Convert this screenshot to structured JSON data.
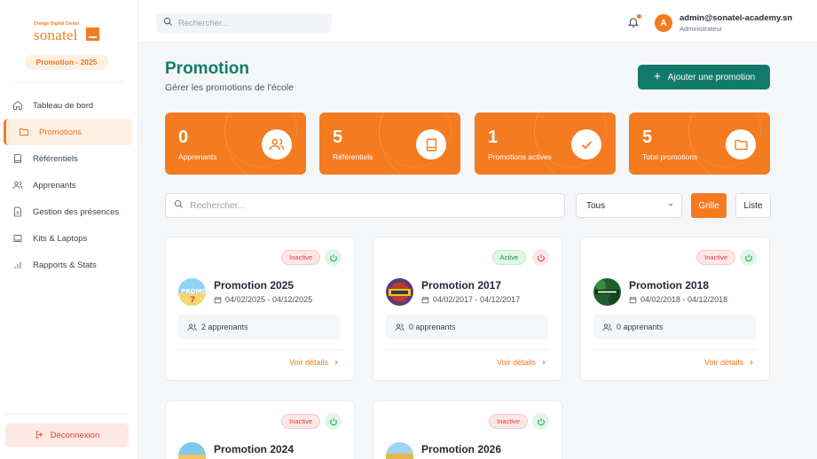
{
  "sidebar": {
    "logo_tagline": "Orange Digital Center",
    "logo_word": "sonatel",
    "promo_pill": "Promotion - 2025",
    "nav": [
      {
        "label": "Tableau de bord",
        "icon": "home-icon"
      },
      {
        "label": "Promotions",
        "icon": "folder-icon",
        "active": true
      },
      {
        "label": "Référentiels",
        "icon": "book-icon"
      },
      {
        "label": "Apprenants",
        "icon": "users-icon"
      },
      {
        "label": "Gestion des présences",
        "icon": "document-icon"
      },
      {
        "label": "Kits & Laptops",
        "icon": "laptop-icon"
      },
      {
        "label": "Rapports & Stats",
        "icon": "bar-chart-icon"
      }
    ],
    "logout_label": "Déconnexion"
  },
  "topbar": {
    "search_placeholder": "Rechercher...",
    "avatar_letter": "A",
    "user_email": "admin@sonatel-academy.sn",
    "user_role": "Administrateur"
  },
  "main": {
    "title": "Promotion",
    "subtitle": "Gérer les promotions de l'école",
    "add_button": "Ajouter une promotion",
    "stats": [
      {
        "value": "0",
        "label": "Apprenants",
        "icon": "users-icon"
      },
      {
        "value": "5",
        "label": "Référentiels",
        "icon": "book-icon"
      },
      {
        "value": "1",
        "label": "Promotions actives",
        "icon": "check-icon"
      },
      {
        "value": "5",
        "label": "Total promotions",
        "icon": "folder-icon"
      }
    ],
    "filter": {
      "search_placeholder": "Rechercher...",
      "select_value": "Tous",
      "grid_label": "Grille",
      "list_label": "Liste"
    },
    "cards": [
      {
        "status": "Inactive",
        "name": "Promotion 2025",
        "dates": "04/02/2025 - 04/12/2025",
        "count": "2 apprenants",
        "link": "Voir détails"
      },
      {
        "status": "Active",
        "name": "Promotion 2017",
        "dates": "04/02/2017 - 04/12/2017",
        "count": "0 apprenants",
        "link": "Voir détails"
      },
      {
        "status": "Inactive",
        "name": "Promotion 2018",
        "dates": "04/02/2018 - 04/12/2018",
        "count": "0 apprenants",
        "link": "Voir détails"
      },
      {
        "status": "Inactive",
        "name": "Promotion 2024"
      },
      {
        "status": "Inactive",
        "name": "Promotion 2026"
      }
    ]
  },
  "colors": {
    "accent": "#f47b20",
    "teal": "#137a6b",
    "danger": "#d93f3f",
    "success": "#27a153"
  }
}
